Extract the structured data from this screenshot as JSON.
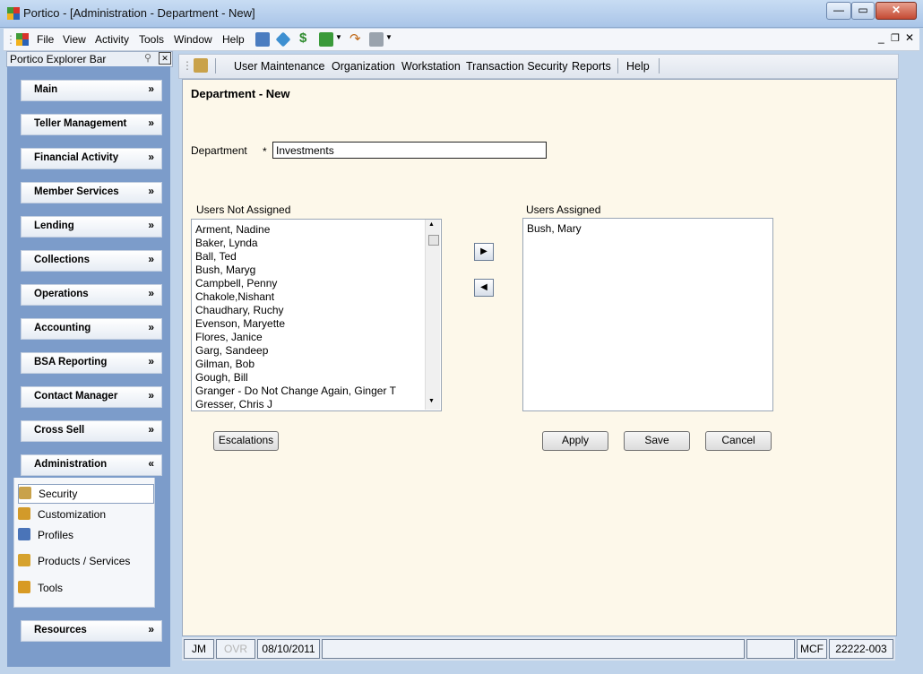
{
  "window": {
    "title": "Portico - [Administration - Department - New]"
  },
  "menubar": {
    "items": [
      "File",
      "View",
      "Activity",
      "Tools",
      "Window",
      "Help"
    ]
  },
  "explorer": {
    "title": "Portico Explorer Bar",
    "sections": [
      "Main",
      "Teller Management",
      "Financial Activity",
      "Member Services",
      "Lending",
      "Collections",
      "Operations",
      "Accounting",
      "BSA Reporting",
      "Contact Manager",
      "Cross Sell",
      "Administration",
      "Resources"
    ],
    "admin_items": [
      "Security",
      "Customization",
      "Profiles",
      "Products / Services",
      "Tools"
    ]
  },
  "main_menu": {
    "items": [
      "User Maintenance",
      "Organization",
      "Workstation",
      "Transaction Security",
      "Reports",
      "Help"
    ]
  },
  "form": {
    "title": "Department - New",
    "department_label": "Department",
    "required_mark": "*",
    "department_value": "Investments",
    "not_assigned_label": "Users Not Assigned",
    "assigned_label": "Users Assigned",
    "not_assigned": [
      "Arment, Nadine",
      "Baker, Lynda",
      "Ball, Ted",
      "Bush, Maryg",
      "Campbell, Penny",
      "Chakole,Nishant",
      "Chaudhary, Ruchy",
      "Evenson, Maryette",
      "Flores, Janice",
      "Garg, Sandeep",
      "Gilman, Bob",
      "Gough, Bill",
      "Granger - Do Not Change Again, Ginger T",
      "Gresser, Chris J"
    ],
    "assigned": [
      "Bush, Mary"
    ],
    "buttons": {
      "escalations": "Escalations",
      "apply": "Apply",
      "save": "Save",
      "cancel": "Cancel"
    }
  },
  "status": {
    "user": "JM",
    "ovr": "OVR",
    "date": "08/10/2011",
    "mode": "MCF",
    "account": "22222-003"
  }
}
